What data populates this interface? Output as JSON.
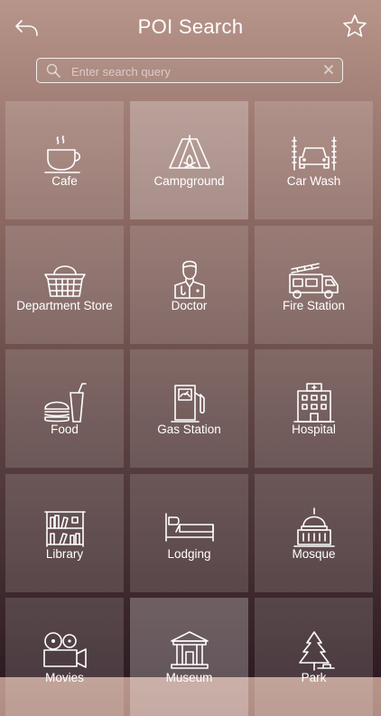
{
  "header": {
    "title": "POI Search",
    "back_icon": "back-arrow-icon",
    "star_icon": "star-icon"
  },
  "search": {
    "placeholder": "Enter search query",
    "value": ""
  },
  "categories": [
    {
      "label": "Cafe",
      "icon": "coffee-cup-icon"
    },
    {
      "label": "Campground",
      "icon": "tent-icon"
    },
    {
      "label": "Car Wash",
      "icon": "car-wash-icon"
    },
    {
      "label": "Department Store",
      "icon": "shopping-basket-icon"
    },
    {
      "label": "Doctor",
      "icon": "doctor-icon"
    },
    {
      "label": "Fire Station",
      "icon": "fire-truck-icon"
    },
    {
      "label": "Food",
      "icon": "burger-drink-icon"
    },
    {
      "label": "Gas Station",
      "icon": "gas-pump-icon"
    },
    {
      "label": "Hospital",
      "icon": "hospital-building-icon"
    },
    {
      "label": "Library",
      "icon": "bookshelf-icon"
    },
    {
      "label": "Lodging",
      "icon": "bed-icon"
    },
    {
      "label": "Mosque",
      "icon": "dome-building-icon"
    },
    {
      "label": "Movies",
      "icon": "movie-camera-icon"
    },
    {
      "label": "Museum",
      "icon": "museum-icon"
    },
    {
      "label": "Park",
      "icon": "tree-icon"
    }
  ],
  "colors": {
    "gradient_top": "#b8958a",
    "gradient_bottom": "#2e1c22"
  }
}
